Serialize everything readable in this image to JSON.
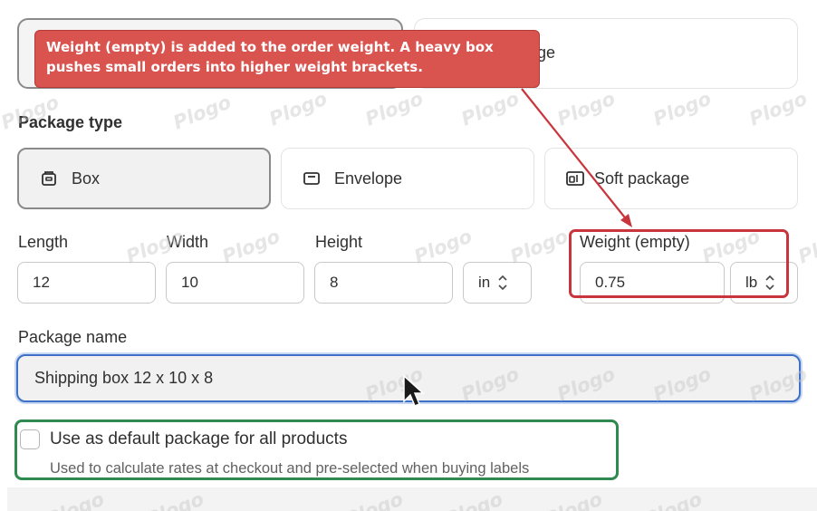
{
  "top_options": {
    "right_partial_label": "ge"
  },
  "package_type": {
    "section_label": "Package type",
    "options": [
      {
        "label": "Box",
        "icon": "box-icon",
        "selected": true
      },
      {
        "label": "Envelope",
        "icon": "envelope-icon",
        "selected": false
      },
      {
        "label": "Soft package",
        "icon": "soft-package-icon",
        "selected": false
      }
    ]
  },
  "dimensions": {
    "length": {
      "label": "Length",
      "value": "12"
    },
    "width": {
      "label": "Width",
      "value": "10"
    },
    "height": {
      "label": "Height",
      "value": "8"
    },
    "length_unit": "in",
    "weight": {
      "label": "Weight (empty)",
      "value": "0.75"
    },
    "weight_unit": "lb"
  },
  "package_name": {
    "label": "Package name",
    "value": "Shipping box 12 x 10 x 8"
  },
  "default_option": {
    "label": "Use as default package for all products",
    "help": "Used to calculate rates at checkout and pre-selected when buying labels",
    "checked": false
  },
  "annotation": {
    "callout_line1": "Weight (empty) is added to the order weight. A heavy box",
    "callout_line2": "pushes small orders into higher weight brackets."
  },
  "watermark": "Plogo",
  "colors": {
    "callout_bg": "#d9534f",
    "highlight_red": "#c9353c",
    "highlight_green": "#2e8a4f",
    "focus_blue": "#3d70c6"
  }
}
